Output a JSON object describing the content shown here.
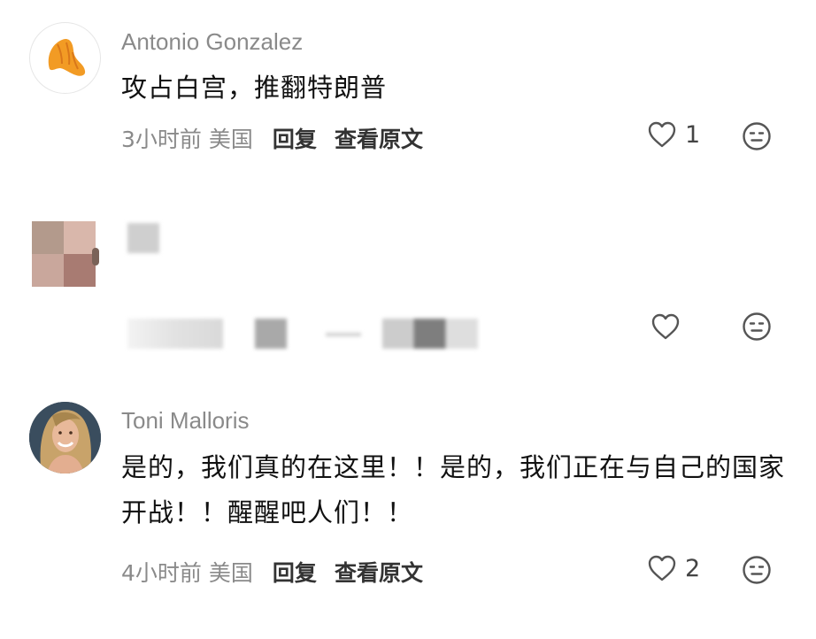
{
  "comments": [
    {
      "username": "Antonio Gonzalez",
      "text": "攻占白宫，推翻特朗普",
      "time": "3小时前",
      "location": "美国",
      "reply_label": "回复",
      "original_label": "查看原文",
      "like_count": "1",
      "avatar": "croissant-icon"
    },
    {
      "username": "",
      "text": "",
      "avatar": "pixelated-avatar",
      "note_blurred": true
    },
    {
      "username": "Toni Malloris",
      "text": "是的，我们真的在这里！！是的，我们正在与自己的国家开战！！醒醒吧人们！！",
      "time": "4小时前",
      "location": "美国",
      "reply_label": "回复",
      "original_label": "查看原文",
      "like_count": "2",
      "avatar": "profile-photo"
    }
  ],
  "icons": {
    "like": "heart-outline-icon",
    "reaction": "emoji-face-icon"
  },
  "colors": {
    "meta_gray": "#8a8a8a",
    "text": "#111111",
    "icon": "#555555"
  }
}
